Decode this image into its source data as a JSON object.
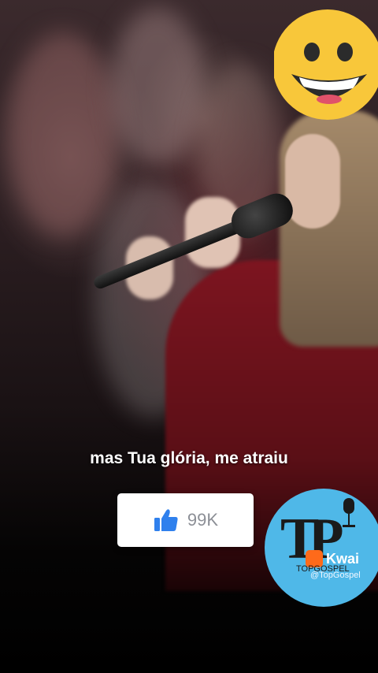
{
  "video": {
    "lyric": "mas Tua glória, me atraiu",
    "like_count": "99K",
    "like_icon": "thumbs-up-icon",
    "emoji": "grinning-face-emoji"
  },
  "watermark": {
    "logo_letters": "TP",
    "channel_name": "TOPGOSPEL",
    "app_name": "Kwai",
    "handle": "@TopGospel"
  },
  "colors": {
    "like_blue": "#2f80ed",
    "emoji_yellow": "#f8c73a",
    "logo_blue": "#4fb8e8",
    "kwai_orange": "#ff6a1a"
  }
}
